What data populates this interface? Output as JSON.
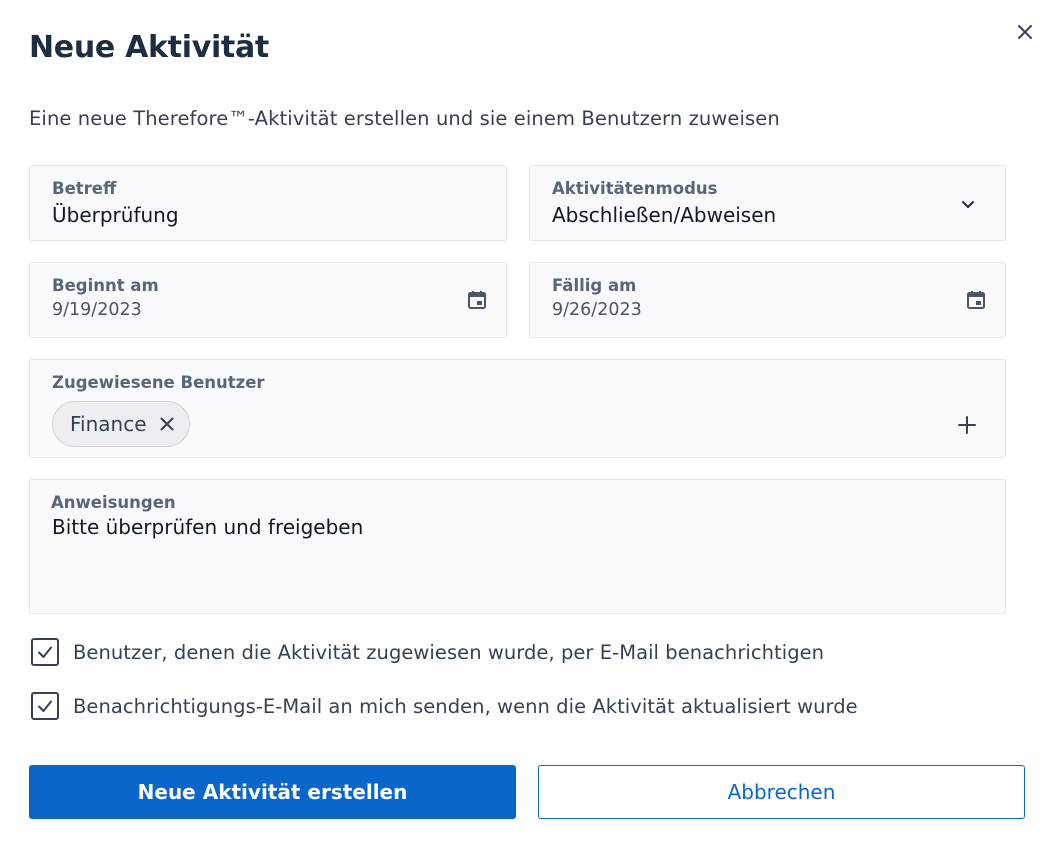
{
  "dialog": {
    "title": "Neue Aktivität",
    "subtitle": "Eine neue Therefore™-Aktivität erstellen und sie einem Benutzern zuweisen",
    "close_icon": "close-icon"
  },
  "fields": {
    "betreff": {
      "label": "Betreff",
      "value": "Überprüfung"
    },
    "modus": {
      "label": "Aktivitätenmodus",
      "value": "Abschließen/Abweisen",
      "icon": "chevron-down-icon"
    },
    "start": {
      "label": "Beginnt am",
      "value": "9/19/2023",
      "icon": "calendar-icon"
    },
    "due": {
      "label": "Fällig am",
      "value": "9/26/2023",
      "icon": "calendar-icon"
    },
    "users": {
      "label": "Zugewiesene Benutzer",
      "chips": [
        {
          "label": "Finance"
        }
      ],
      "add_icon": "plus-icon"
    },
    "instructions": {
      "label": "Anweisungen",
      "value": "Bitte überprüfen und freigeben"
    }
  },
  "options": [
    {
      "label": "Benutzer, denen die Aktivität zugewiesen wurde, per E-Mail benachrichtigen",
      "checked": true
    },
    {
      "label": "Benachrichtigungs-E-Mail an mich senden, wenn die Aktivität aktualisiert wurde",
      "checked": true
    }
  ],
  "actions": {
    "create_label": "Neue Aktivität erstellen",
    "cancel_label": "Abbrechen"
  },
  "colors": {
    "primary": "#0b66cc",
    "title": "#1f2d40",
    "field_bg": "#f9fafb",
    "field_border": "#e5e7eb"
  }
}
